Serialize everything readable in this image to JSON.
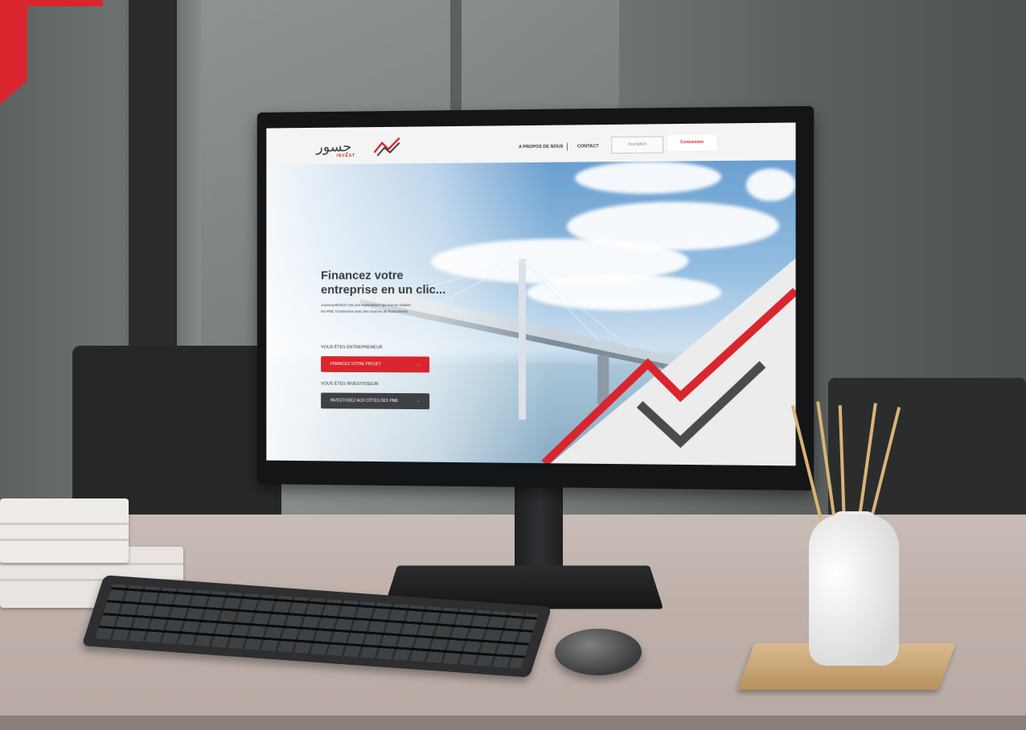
{
  "website": {
    "logo_arabic": "جسور",
    "logo_sub": "INVEST",
    "nav": {
      "about": "A PROPOS DE NOUS",
      "contact": "CONTACT",
      "inscription": "Inscription",
      "connexion": "Connexion"
    },
    "hero": {
      "title_line1": "Financez votre",
      "title_line2": "entreprise en un clic...",
      "description": "JoussourINVEST est une marketplace qui met en relation les PME Tunisiennes avec des sources de financement.",
      "entrepreneur_label": "VOUS ÊTES ENTREPRENEUR",
      "entrepreneur_cta": "FINANCEZ VOTRE PROJET",
      "investor_label": "VOUS ÊTES INVESTISSEUR",
      "investor_cta": "INVESTISSEZ AUX CÔTÉS DES PME",
      "arrow": "→"
    }
  },
  "colors": {
    "brand_red": "#d9262e",
    "brand_dark": "#3f4044"
  }
}
